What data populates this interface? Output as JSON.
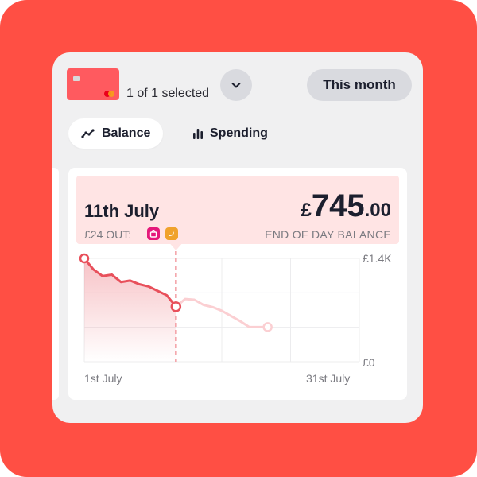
{
  "header": {
    "selected_text": "1 of 1 selected",
    "range_label": "This month",
    "dropdown_icon": "chevron-down-icon"
  },
  "tabs": [
    {
      "label": "Balance",
      "icon": "line-chart-icon",
      "active": true
    },
    {
      "label": "Spending",
      "icon": "bar-chart-icon",
      "active": false
    }
  ],
  "summary": {
    "date": "11th July",
    "out": "£24 OUT:",
    "currency": "£",
    "amount_main": "745",
    "amount_decimal": ".00",
    "balance_label": "END OF DAY BALANCE",
    "badges": [
      {
        "icon": "shopping-bag-icon",
        "color": "#e5197b"
      },
      {
        "icon": "banana-icon",
        "color": "#f0a22b"
      }
    ]
  },
  "colors": {
    "background": "#ff4f44",
    "accent": "#e8505b",
    "projection": "#fbcfd2"
  },
  "chart_data": {
    "type": "line",
    "ylim": [
      0,
      1400
    ],
    "yticks": [
      "£1.4K",
      "£0"
    ],
    "x_labels": [
      "1st July",
      "31st July"
    ],
    "x_range": [
      1,
      31
    ],
    "selected_day": 11,
    "series": [
      {
        "kind": "actual",
        "x": [
          1,
          2,
          3,
          4,
          5,
          6,
          7,
          8,
          9,
          10,
          11
        ],
        "y": [
          1400,
          1250,
          1160,
          1180,
          1080,
          1100,
          1050,
          1020,
          960,
          900,
          745
        ]
      },
      {
        "kind": "projected",
        "x": [
          11,
          12,
          13,
          14,
          15,
          16,
          17,
          18,
          19,
          20,
          21
        ],
        "y": [
          745,
          850,
          840,
          770,
          740,
          690,
          620,
          550,
          470,
          470,
          470
        ]
      }
    ]
  }
}
